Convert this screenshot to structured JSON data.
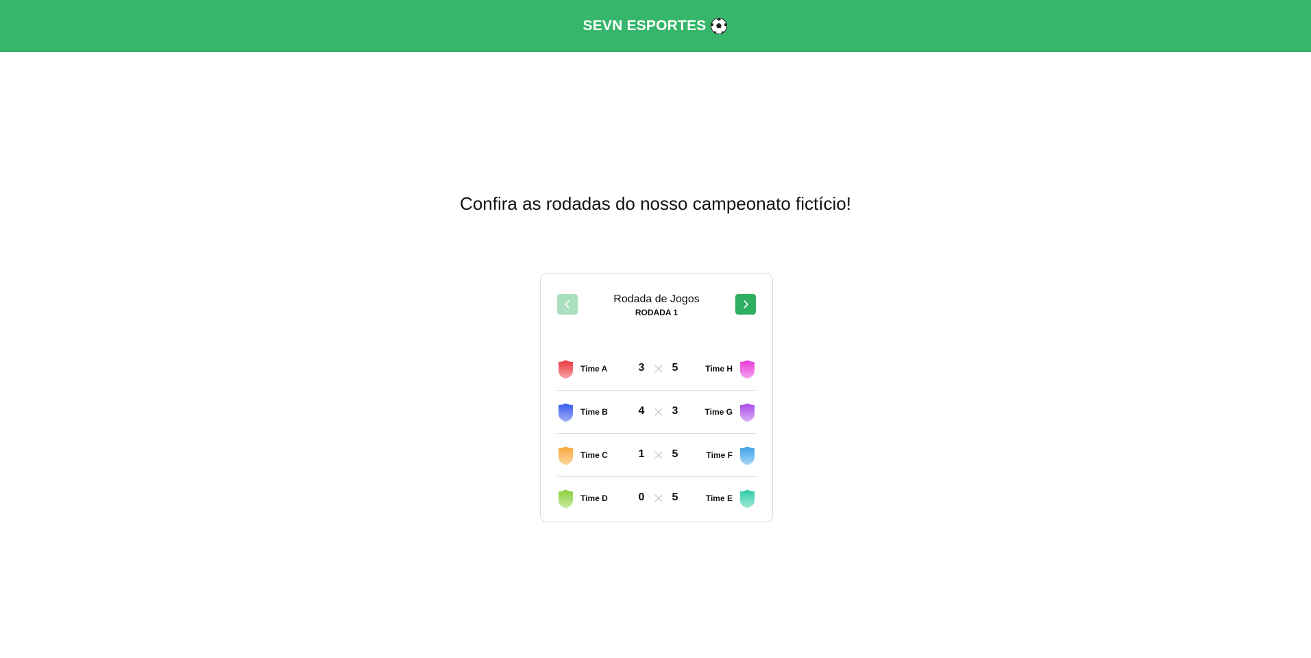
{
  "header": {
    "brand": "SEVN ESPORTES",
    "brand_icon": "soccer-ball-icon",
    "color": "#35b66a"
  },
  "main": {
    "headline": "Confira as rodadas do nosso campeonato fictício!"
  },
  "round_card": {
    "title": "Rodada de Jogos",
    "round_label": "RODADA 1",
    "prev_icon": "chevron-left-icon",
    "next_icon": "chevron-right-icon",
    "prev_enabled": false,
    "next_enabled": true,
    "matches": [
      {
        "home": {
          "name": "Time A",
          "score": "3",
          "colors": [
            "#e8393f",
            "#f6a3a6"
          ]
        },
        "away": {
          "name": "Time H",
          "score": "5",
          "colors": [
            "#e639d6",
            "#f7a4ef"
          ]
        }
      },
      {
        "home": {
          "name": "Time B",
          "score": "4",
          "colors": [
            "#3558f0",
            "#a3b3f7"
          ]
        },
        "away": {
          "name": "Time G",
          "score": "3",
          "colors": [
            "#a64be8",
            "#dcb1f6"
          ]
        }
      },
      {
        "home": {
          "name": "Time C",
          "score": "1",
          "colors": [
            "#f7a436",
            "#fbd9a2"
          ]
        },
        "away": {
          "name": "Time F",
          "score": "5",
          "colors": [
            "#3aa0e6",
            "#a8d6f6"
          ]
        }
      },
      {
        "home": {
          "name": "Time D",
          "score": "0",
          "colors": [
            "#88cf3a",
            "#cbeaa6"
          ]
        },
        "away": {
          "name": "Time E",
          "score": "5",
          "colors": [
            "#29c9a3",
            "#a6ecd9"
          ]
        }
      }
    ]
  }
}
